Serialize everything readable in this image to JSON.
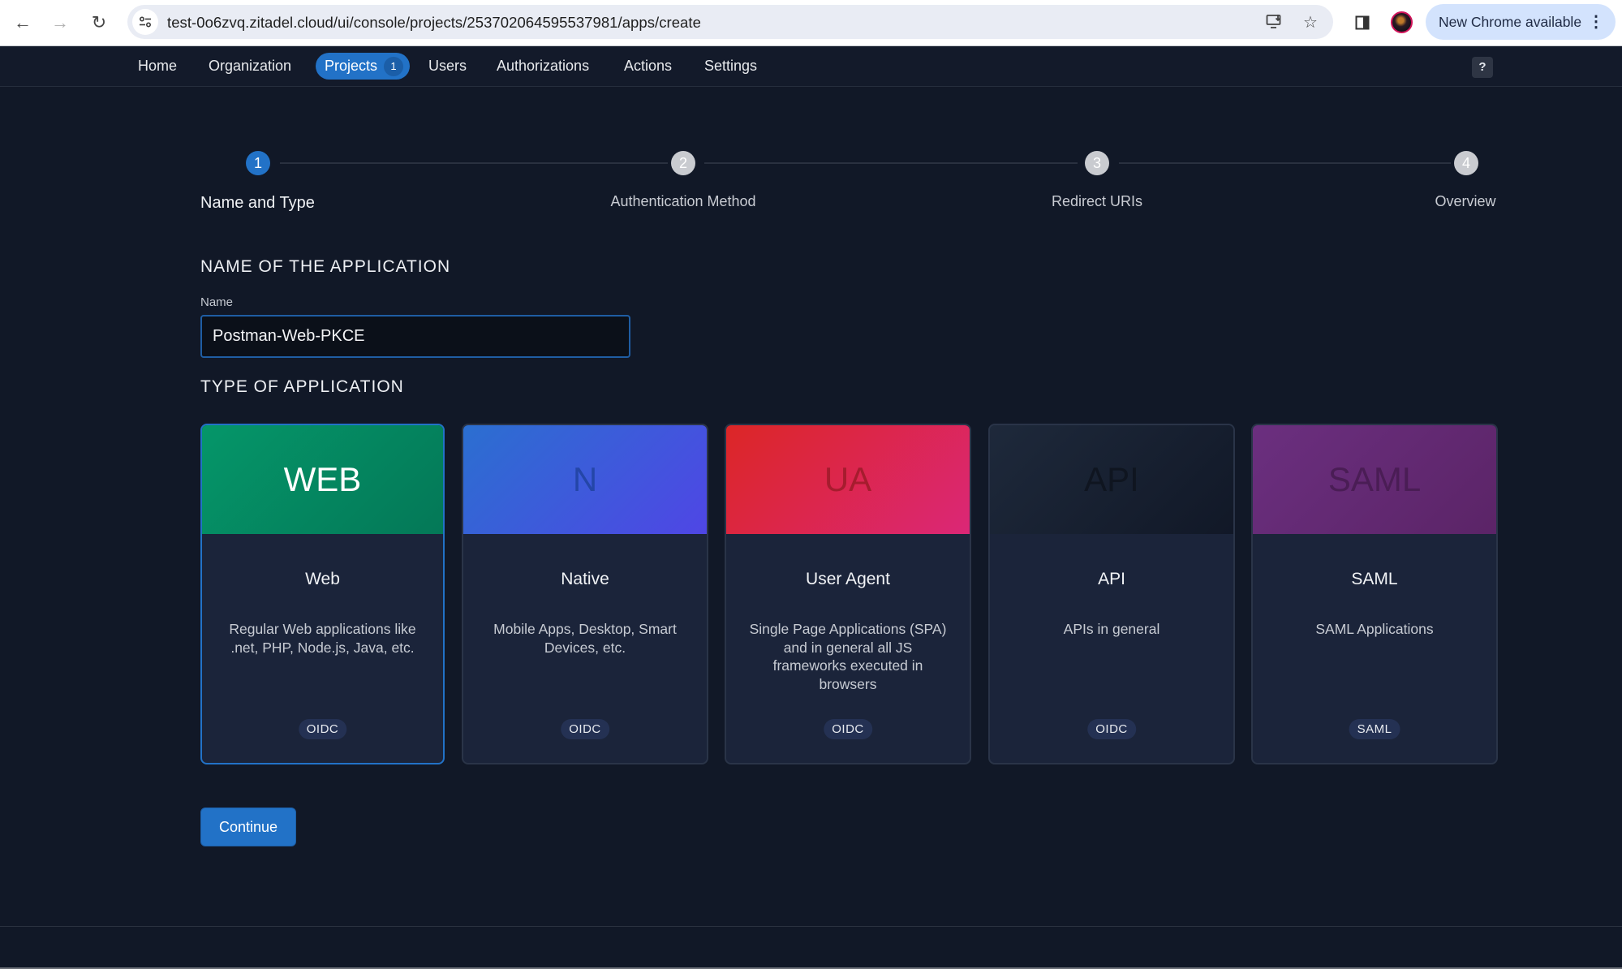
{
  "browser": {
    "url": "test-0o6zvq.zitadel.cloud/ui/console/projects/253702064595537981/apps/create",
    "update_label": "New Chrome available",
    "icons": {
      "back": "back-arrow-icon",
      "forward": "forward-arrow-icon",
      "reload": "reload-icon",
      "site_info": "tune-icon",
      "install": "install-app-icon",
      "bookmark": "star-icon",
      "side_panel": "side-panel-icon",
      "profile": "avatar",
      "menu": "kebab-menu-icon"
    }
  },
  "nav": {
    "items": [
      {
        "label": "Home"
      },
      {
        "label": "Organization"
      },
      {
        "label": "Projects",
        "badge": "1",
        "active": true
      },
      {
        "label": "Users"
      },
      {
        "label": "Authorizations"
      },
      {
        "label": "Actions"
      },
      {
        "label": "Settings"
      }
    ],
    "help_label": "?"
  },
  "stepper": {
    "current_step": 1,
    "steps": [
      {
        "number": "1",
        "label": "Name and Type"
      },
      {
        "number": "2",
        "label": "Authentication Method"
      },
      {
        "number": "3",
        "label": "Redirect URIs"
      },
      {
        "number": "4",
        "label": "Overview"
      }
    ]
  },
  "form": {
    "name_section_title": "NAME OF THE APPLICATION",
    "name_label": "Name",
    "name_value": "Postman-Web-PKCE",
    "type_section_title": "TYPE OF APPLICATION"
  },
  "app_types": [
    {
      "abbr": "WEB",
      "title": "Web",
      "description": "Regular Web applications like .net, PHP, Node.js, Java, etc.",
      "tag": "OIDC",
      "selected": true,
      "color_from": "#059669",
      "color_to": "#047857",
      "abbr_color": "#ffffff"
    },
    {
      "abbr": "N",
      "title": "Native",
      "description": "Mobile Apps, Desktop, Smart Devices, etc.",
      "tag": "OIDC",
      "selected": false,
      "color_from": "#2b6fd0",
      "color_to": "#4f46e5",
      "abbr_color": "#2446a8"
    },
    {
      "abbr": "UA",
      "title": "User Agent",
      "description": "Single Page Applications (SPA) and in general all JS frameworks executed in browsers",
      "tag": "OIDC",
      "selected": false,
      "color_from": "#dc2626",
      "color_to": "#db2777",
      "abbr_color": "#a61c2e"
    },
    {
      "abbr": "API",
      "title": "API",
      "description": "APIs in general",
      "tag": "OIDC",
      "selected": false,
      "color_from": "#1e293b",
      "color_to": "#111827",
      "abbr_color": "#0f1520"
    },
    {
      "abbr": "SAML",
      "title": "SAML",
      "description": "SAML Applications",
      "tag": "SAML",
      "selected": false,
      "color_from": "#6b2f7f",
      "color_to": "#5b2467",
      "abbr_color": "#4a1d55"
    }
  ],
  "actions": {
    "continue_label": "Continue"
  }
}
